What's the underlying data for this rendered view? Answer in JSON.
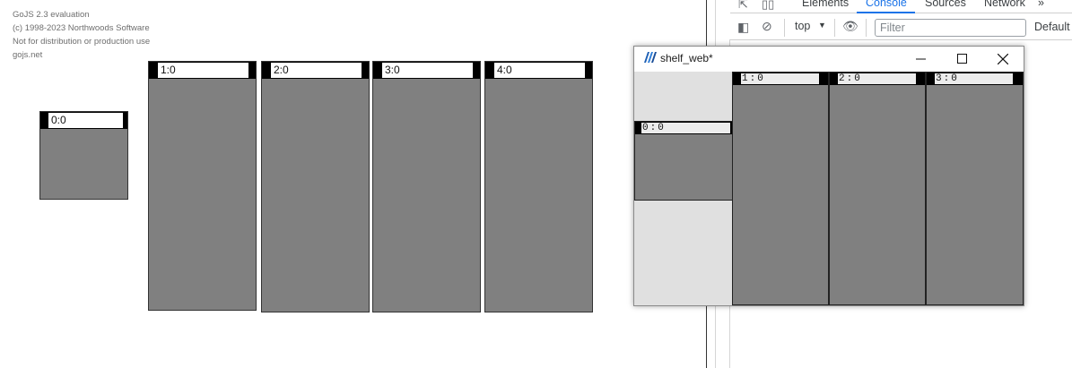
{
  "watermark": {
    "line1": "GoJS 2.3 evaluation",
    "line2": "(c) 1998-2023 Northwoods Software",
    "line3": "Not for distribution or production use",
    "line4": "gojs.net"
  },
  "canvas": {
    "shelves": [
      {
        "label": "0:0"
      },
      {
        "label": "1:0"
      },
      {
        "label": "2:0"
      },
      {
        "label": "3:0"
      },
      {
        "label": "4:0"
      }
    ]
  },
  "devtools": {
    "tabs": [
      "Elements",
      "Console",
      "Sources",
      "Network"
    ],
    "active_tab": "Console",
    "more_tabs": "»",
    "context": "top",
    "filter_placeholder": "Filter",
    "levels": "Default"
  },
  "app_window": {
    "title": "shelf_web*",
    "shelves": [
      {
        "label": "0:0"
      },
      {
        "label": "1:0"
      },
      {
        "label": "2:0"
      },
      {
        "label": "3:0"
      }
    ]
  },
  "colors": {
    "shelf_fill": "#808080",
    "shelf_header": "#000000",
    "window_bg": "#e0e0e0",
    "devtools_accent": "#1a73e8"
  }
}
